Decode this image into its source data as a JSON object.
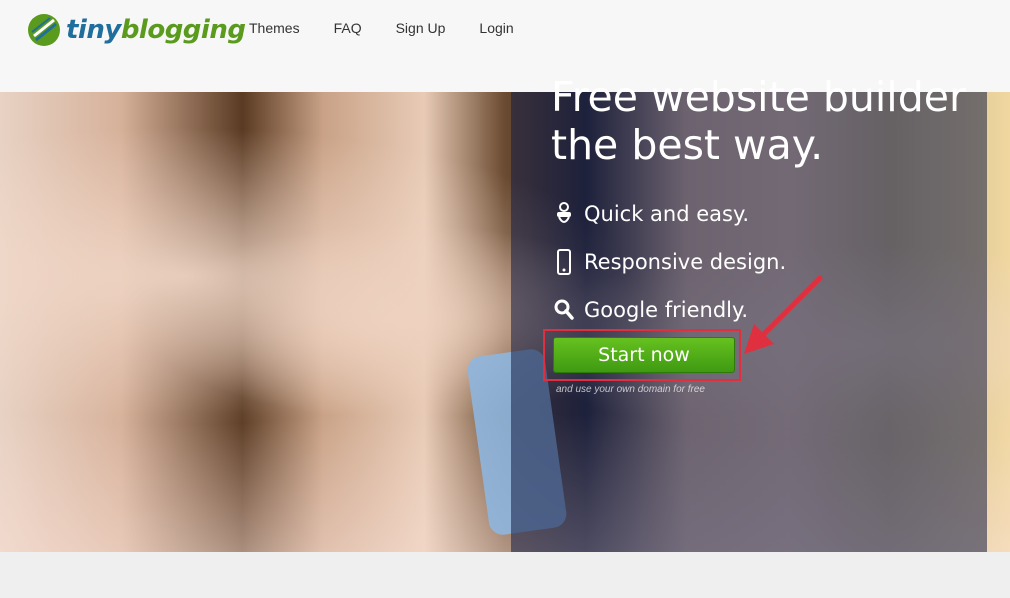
{
  "brand": {
    "name_part1": "tiny",
    "name_part2": "blogging",
    "color_primary": "#1f6e9c",
    "color_secondary": "#5a9a1c"
  },
  "nav": {
    "items": [
      {
        "label": "Themes"
      },
      {
        "label": "FAQ"
      },
      {
        "label": "Sign Up"
      },
      {
        "label": "Login"
      }
    ]
  },
  "hero": {
    "headline_line1": "Free website builder",
    "headline_line2": "the best way.",
    "features": [
      {
        "icon": "pacifier-icon",
        "label": "Quick and easy."
      },
      {
        "icon": "mobile-phone-icon",
        "label": "Responsive design."
      },
      {
        "icon": "search-icon",
        "label": "Google friendly."
      }
    ],
    "cta_label": "Start now",
    "cta_color": "#4fab16",
    "cta_subtext": "and use your own domain for free",
    "highlight_color": "#e0303f"
  }
}
